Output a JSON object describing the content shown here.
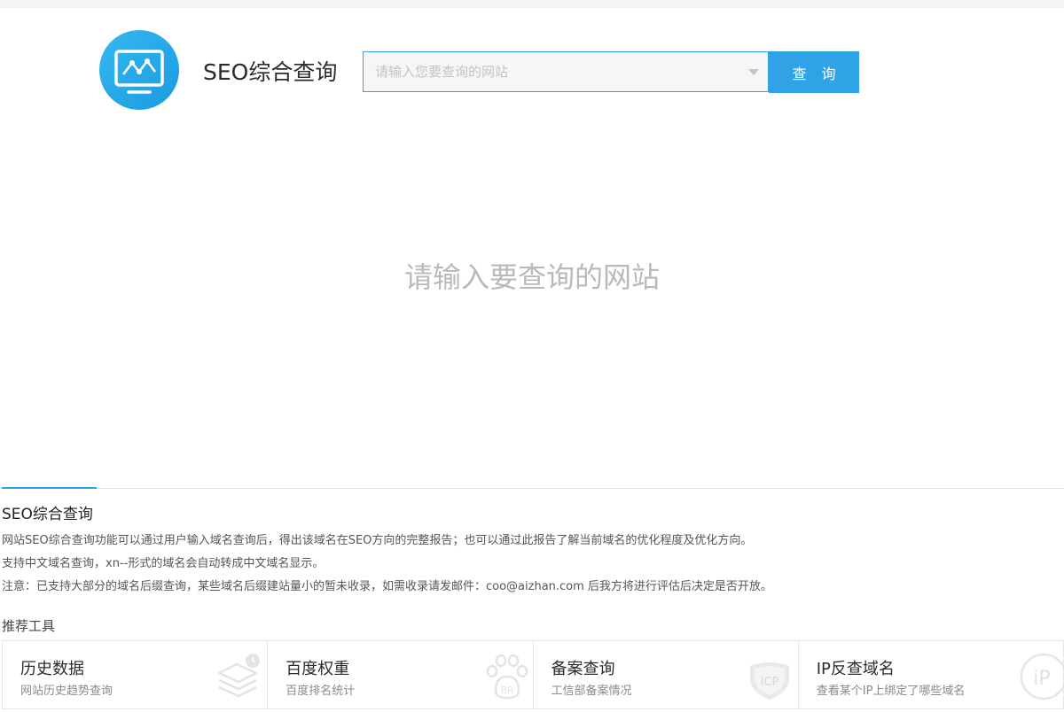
{
  "brand": {
    "title": "SEO综合查询"
  },
  "search": {
    "placeholder": "请输入您要查询的网站",
    "value": "",
    "button_label": "查 询"
  },
  "hint": "请输入要查询的网站",
  "section": {
    "title": "SEO综合查询",
    "lines": [
      "网站SEO综合查询功能可以通过用户输入域名查询后，得出该域名在SEO方向的完整报告；也可以通过此报告了解当前域名的优化程度及优化方向。",
      "支持中文域名查询，xn--形式的域名会自动转成中文域名显示。",
      "注意：已支持大部分的域名后缀查询，某些域名后缀建站量小的暂未收录，如需收录请发邮件：coo@aizhan.com 后我方将进行评估后决定是否开放。"
    ]
  },
  "recommend": {
    "title": "推荐工具",
    "tools": [
      {
        "title": "历史数据",
        "subtitle": "网站历史趋势查询",
        "icon": "stack-clock-icon"
      },
      {
        "title": "百度权重",
        "subtitle": "百度排名统计",
        "icon": "paw-br-icon"
      },
      {
        "title": "备案查询",
        "subtitle": "工信部备案情况",
        "icon": "icp-shield-icon",
        "icon_text": "ICP"
      },
      {
        "title": "IP反查域名",
        "subtitle": "查看某个IP上绑定了哪些域名",
        "icon": "ip-circle-icon",
        "icon_text": "iP"
      }
    ]
  },
  "colors": {
    "accent": "#2fa3e6",
    "hint": "#b9b9b9",
    "icon_watermark": "#ececec"
  }
}
